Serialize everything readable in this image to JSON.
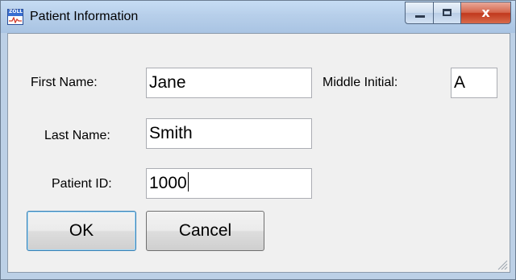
{
  "window": {
    "title": "Patient Information",
    "icon": "zoll-waveform-icon"
  },
  "caption_buttons": {
    "minimize": "minimize",
    "maximize": "maximize",
    "close": "x"
  },
  "form": {
    "first_name_label": "First Name:",
    "first_name_value": "Jane",
    "middle_initial_label": "Middle Initial:",
    "middle_initial_value": "A",
    "last_name_label": "Last Name:",
    "last_name_value": "Smith",
    "patient_id_label": "Patient ID:",
    "patient_id_value": "1000"
  },
  "buttons": {
    "ok": "OK",
    "cancel": "Cancel"
  },
  "colors": {
    "title_bar": "#b7cfea",
    "close_button": "#c1381c",
    "default_button_border": "#3c7fb1"
  }
}
